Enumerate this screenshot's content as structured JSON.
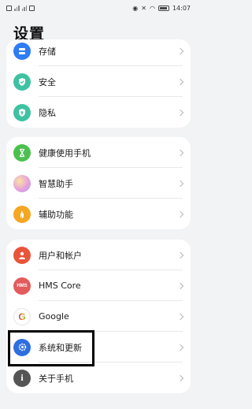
{
  "status": {
    "time": "14:07"
  },
  "page": {
    "title": "设置"
  },
  "group1": [
    {
      "label": "存储",
      "icon": "storage-icon",
      "color": "#2e7cf6"
    },
    {
      "label": "安全",
      "icon": "security-shield-icon",
      "color": "#3ec2a2"
    },
    {
      "label": "隐私",
      "icon": "privacy-icon",
      "color": "#3ec2a2"
    }
  ],
  "group2": [
    {
      "label": "健康使用手机",
      "icon": "hourglass-icon",
      "color": "#4cc04e"
    },
    {
      "label": "智慧助手",
      "icon": "smart-assistant-icon",
      "color": "#e59be0"
    },
    {
      "label": "辅助功能",
      "icon": "accessibility-hand-icon",
      "color": "#f5a623"
    }
  ],
  "group3": [
    {
      "label": "用户和帐户",
      "icon": "user-icon",
      "color": "#e8553a"
    },
    {
      "label": "HMS Core",
      "icon": "hms-icon",
      "color": "#e35b5b",
      "badge": "HMS"
    },
    {
      "label": "Google",
      "icon": "google-icon",
      "color": "#ffffff",
      "badge": "G"
    },
    {
      "label": "系统和更新",
      "icon": "system-gear-icon",
      "color": "#2e6fe0"
    },
    {
      "label": "关于手机",
      "icon": "info-icon",
      "color": "#555555",
      "badge": "i"
    }
  ]
}
